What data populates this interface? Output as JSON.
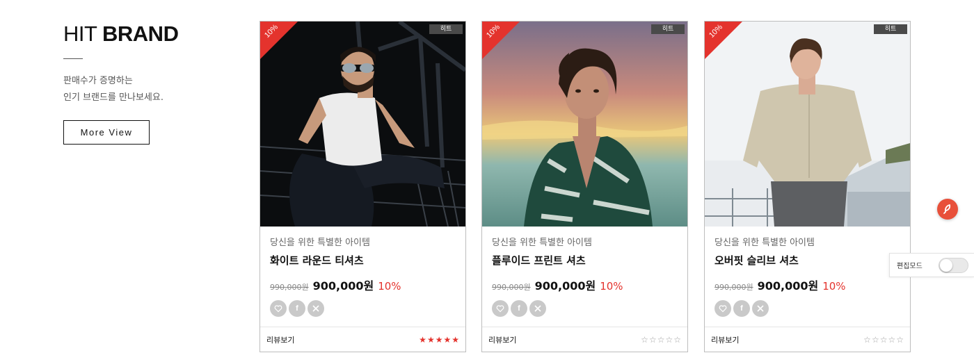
{
  "intro": {
    "title_light": "HIT",
    "title_bold": "BRAND",
    "desc_line1": "판매수가 증명하는",
    "desc_line2": "인기 브랜드를 만나보세요.",
    "more_button": "More View"
  },
  "cards": [
    {
      "discount_ribbon": "10%",
      "badge": "히트",
      "subtitle": "당신을 위한 특별한 아이템",
      "name": "화이트 라운드 티셔츠",
      "original_price": "990,000원",
      "sale_price": "900,000원",
      "discount": "10%",
      "review_label": "리뷰보기",
      "rating": 5,
      "rating_max": 5
    },
    {
      "discount_ribbon": "10%",
      "badge": "히트",
      "subtitle": "당신을 위한 특별한 아이템",
      "name": "플루이드 프린트 셔츠",
      "original_price": "990,000원",
      "sale_price": "900,000원",
      "discount": "10%",
      "review_label": "리뷰보기",
      "rating": 0,
      "rating_max": 5
    },
    {
      "discount_ribbon": "10%",
      "badge": "히트",
      "subtitle": "당신을 위한 특별한 아이템",
      "name": "오버핏 슬리브 셔츠",
      "original_price": "990,000원",
      "sale_price": "900,000원",
      "discount": "10%",
      "review_label": "리뷰보기",
      "rating": 0,
      "rating_max": 5
    }
  ],
  "social_icons": [
    "heart-icon",
    "facebook-icon",
    "x-icon"
  ],
  "floating_button_icon": "feather-icon",
  "edit_mode": {
    "label": "편집모드",
    "enabled": false
  },
  "colors": {
    "accent": "#e4332d",
    "badge": "#4a4a4a",
    "social": "#c9c9c9",
    "fab": "#e8503a"
  }
}
